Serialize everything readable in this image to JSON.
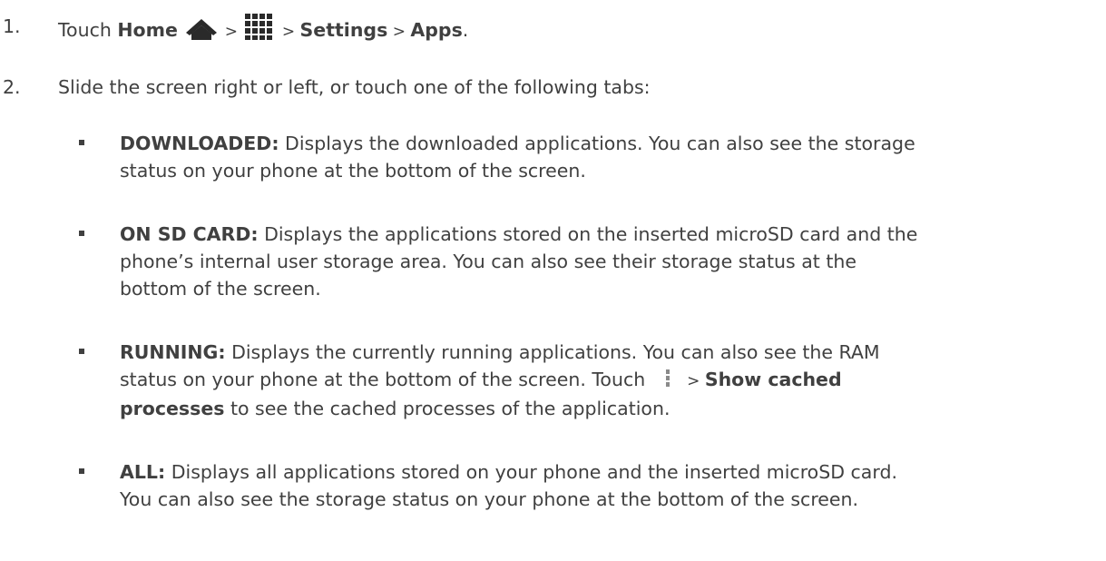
{
  "steps": [
    {
      "num": "1.",
      "prefix": "Touch ",
      "home_label": "Home",
      "sep1": " > ",
      "sep2": " > ",
      "settings_label": "Settings",
      "sep3": " > ",
      "apps_label": "Apps",
      "suffix": ".",
      "home_icon": "home-icon",
      "apps_icon": "app-grid-icon"
    },
    {
      "num": "2.",
      "text": "Slide the screen right or left, or touch one of the following tabs:"
    }
  ],
  "bullets": [
    {
      "term": "DOWNLOADED:",
      "line1": " Displays the downloaded applications. You can also see the storage",
      "line2": "status on your phone at the bottom of the screen."
    },
    {
      "term": "ON SD CARD:",
      "line1": " Displays the applications stored on the inserted microSD card and the",
      "line2": "phone’s internal user storage area. You can also see their storage status at the",
      "line3": "bottom of the screen."
    },
    {
      "term": "RUNNING:",
      "line1": " Displays the currently running applications. You can also see the RAM",
      "line2a": "status on your phone at the bottom of the screen. Touch ",
      "menu_icon": "menu-overflow-icon",
      "line2b": " > ",
      "show_cached": "Show cached",
      "processes": "processes",
      "line3": " to see the cached processes of the application."
    },
    {
      "term": "ALL:",
      "line1": " Displays all applications stored on your phone and the inserted microSD card.",
      "line2": "You can also see the storage status on your phone at the bottom of the screen."
    }
  ],
  "colors": {
    "text": "#404040",
    "icon": "#2a2a2a",
    "menu_icon": "#8a8a8a"
  }
}
